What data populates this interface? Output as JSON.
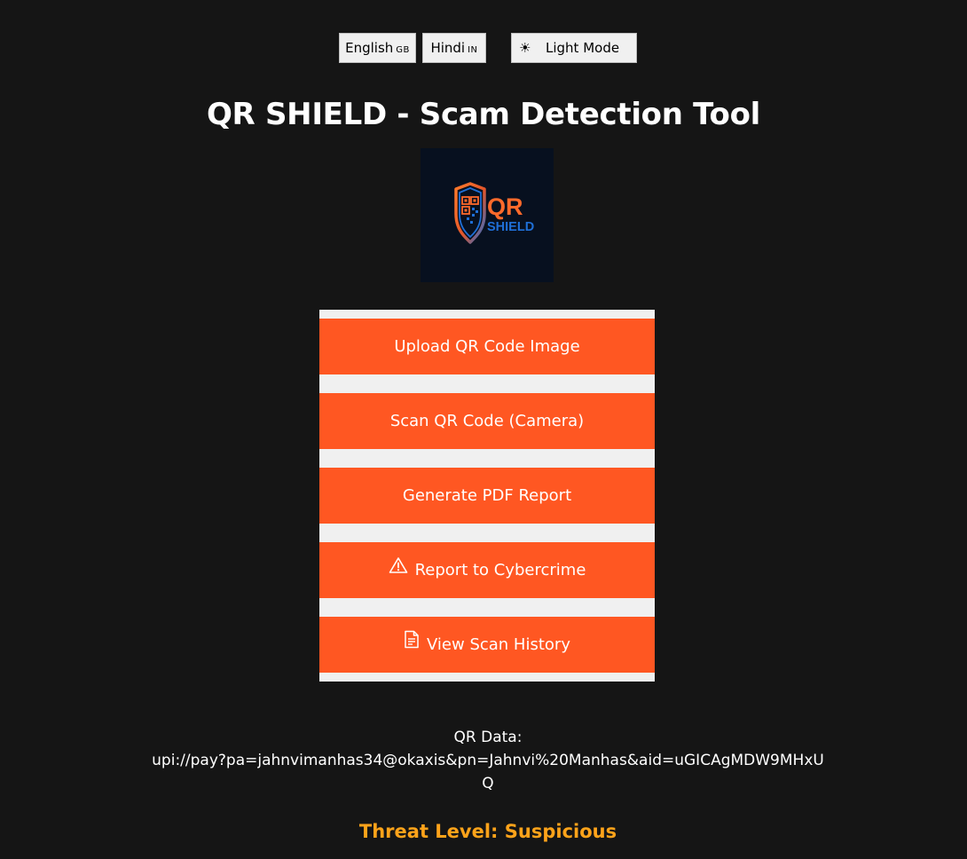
{
  "topbar": {
    "english_label": "English",
    "english_flag": "GB",
    "hindi_label": "Hindi",
    "hindi_flag": "IN",
    "theme_icon": "☀",
    "theme_label": "Light Mode"
  },
  "header": {
    "title": "QR SHIELD - Scam Detection Tool"
  },
  "logo": {
    "word1": "QR",
    "word2": "SHIELD",
    "colors": {
      "background": "#07101f",
      "orange": "#ff6a2b",
      "blue": "#1f6fd6"
    }
  },
  "actions": {
    "upload_label": "Upload QR Code Image",
    "scan_label": "Scan QR Code (Camera)",
    "pdf_label": "Generate PDF Report",
    "report_label": "Report to Cybercrime",
    "report_icon": "warning-icon",
    "history_label": "View Scan History",
    "history_icon": "document-icon",
    "color": "#ff5722"
  },
  "result": {
    "qr_label": "QR Data:",
    "qr_value": "upi://pay?pa=jahnvimanhas34@okaxis&pn=Jahnvi%20Manhas&aid=uGICAgMDW9MHxUQ",
    "threat_text": "Threat Level: Suspicious",
    "threat_color": "#ffa31a"
  },
  "theme": {
    "background": "#151515",
    "panel": "#f0f0f0"
  }
}
